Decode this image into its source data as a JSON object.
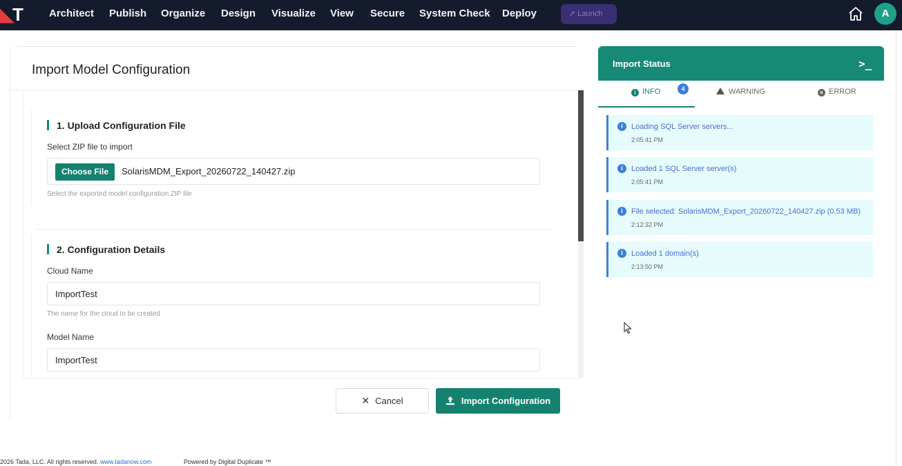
{
  "nav": {
    "logo_text": "T",
    "items": [
      "Architect",
      "Publish",
      "Organize",
      "Design",
      "Visualize",
      "View",
      "Secure",
      "System Check",
      "Deploy"
    ],
    "launch_label": "Launch",
    "avatar_initial": "A"
  },
  "page": {
    "title": "Import Model Configuration"
  },
  "upload": {
    "section_title": "1. Upload Configuration File",
    "label": "Select ZIP file to import",
    "choose_label": "Choose File",
    "file_name": "SolarisMDM_Export_20260722_140427.zip",
    "helper": "Select the exported model configuration ZIP file"
  },
  "details": {
    "section_title": "2. Configuration Details",
    "cloud_label": "Cloud Name",
    "cloud_value": "ImportTest",
    "cloud_helper": "The name for the cloud to be created",
    "model_label": "Model Name",
    "model_value": "ImportTest"
  },
  "actions": {
    "cancel_label": "Cancel",
    "import_label": "Import Configuration"
  },
  "status": {
    "title": "Import Status",
    "tabs": {
      "info": "INFO",
      "info_count": "4",
      "warning": "WARNING",
      "error": "ERROR"
    },
    "logs": [
      {
        "message": "Loading SQL Server servers...",
        "time": "2:05:41 PM"
      },
      {
        "message": "Loaded 1 SQL Server server(s)",
        "time": "2:05:41 PM"
      },
      {
        "message": "File selected: SolarisMDM_Export_20260722_140427.zip (0.53 MB)",
        "time": "2:12:32 PM"
      },
      {
        "message": "Loaded 1 domain(s)",
        "time": "2:13:50 PM"
      }
    ]
  },
  "footer": {
    "copyright": "2026 Tada, LLC. All rights reserved.",
    "link": "www.tadanow.com",
    "powered": "Powered by Digital Duplicate ™"
  },
  "colors": {
    "nav_bg": "#141b2d",
    "accent": "#15826f",
    "info_blue": "#3e7ed8",
    "log_bg": "#e6fbfc"
  }
}
